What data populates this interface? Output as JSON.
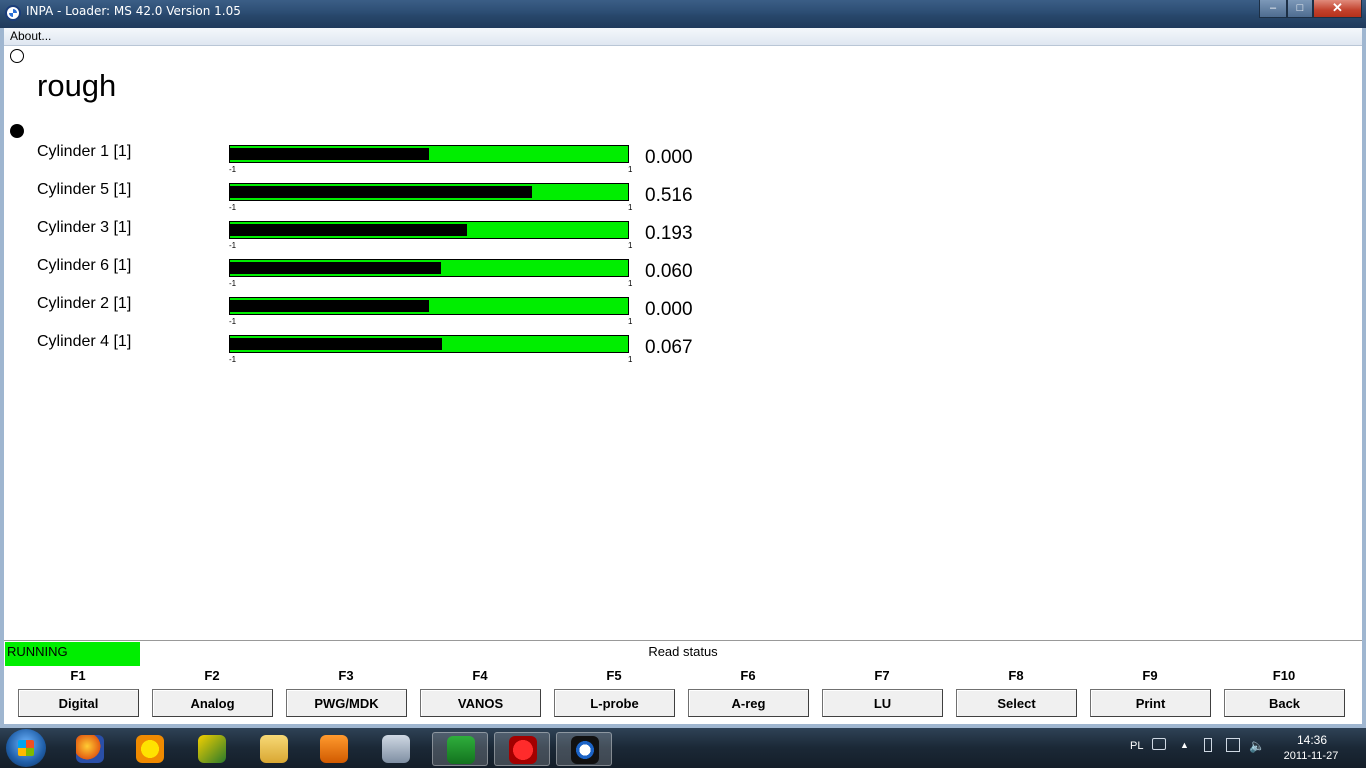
{
  "window": {
    "title": "INPA - Loader:  MS 42.0 Version 1.05",
    "minimize": "–",
    "maximize": "□",
    "close": "✕"
  },
  "menu": {
    "about": "About..."
  },
  "content": {
    "heading": "rough",
    "cylinders": [
      {
        "label": "Cylinder 1 [1]",
        "value": "0.000",
        "min": "-1",
        "max": "1",
        "level": 0.0
      },
      {
        "label": "Cylinder 5 [1]",
        "value": "0.516",
        "min": "-1",
        "max": "1",
        "level": 0.516
      },
      {
        "label": "Cylinder 3 [1]",
        "value": "0.193",
        "min": "-1",
        "max": "1",
        "level": 0.193
      },
      {
        "label": "Cylinder 6 [1]",
        "value": "0.060",
        "min": "-1",
        "max": "1",
        "level": 0.06
      },
      {
        "label": "Cylinder 2 [1]",
        "value": "0.000",
        "min": "-1",
        "max": "1",
        "level": 0.0
      },
      {
        "label": "Cylinder 4 [1]",
        "value": "0.067",
        "min": "-1",
        "max": "1",
        "level": 0.067
      }
    ],
    "bar_color": "#00ee00"
  },
  "status": {
    "state": "RUNNING",
    "message": "Read status",
    "state_color": "#00ee00"
  },
  "function_keys": [
    {
      "key": "F1",
      "label": "Digital"
    },
    {
      "key": "F2",
      "label": "Analog"
    },
    {
      "key": "F3",
      "label": "PWG/MDK"
    },
    {
      "key": "F4",
      "label": "VANOS"
    },
    {
      "key": "F5",
      "label": "L-probe"
    },
    {
      "key": "F6",
      "label": "A-reg"
    },
    {
      "key": "F7",
      "label": "LU"
    },
    {
      "key": "F8",
      "label": "Select"
    },
    {
      "key": "F9",
      "label": "Print"
    },
    {
      "key": "F10",
      "label": "Back"
    }
  ],
  "taskbar": {
    "icons": [
      "firefox-icon",
      "weather-icon",
      "app-icon",
      "folder-icon",
      "media-player-icon",
      "calculator-icon",
      "ediabas-icon",
      "paint-icon",
      "bmw-inpa-icon"
    ],
    "language": "PL",
    "time": "14:36",
    "date": "2011-11-27"
  }
}
